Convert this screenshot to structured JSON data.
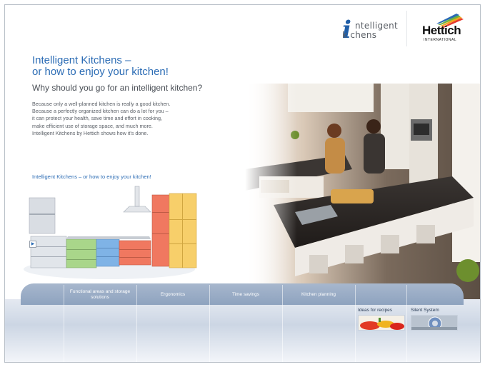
{
  "header": {
    "brand_logo": {
      "line1": "ntelligent",
      "line2": "k  chens",
      "letter": "i"
    },
    "partner_logo": {
      "name": "Hettich",
      "sub": "INTERNATIONAL"
    }
  },
  "intro": {
    "title_line1": "Intelligent Kitchens –",
    "title_line2": "or how to enjoy your kitchen!",
    "subtitle": "Why should you go for an intelligent kitchen?",
    "body_lines": [
      "Because only a well-planned kitchen is really a good kitchen.",
      "Because a perfectly organized kitchen can do a lot for you –",
      "it can protect your health, save time and effort in cooking,",
      "make efficient use of storage space, and much more.",
      "Intelligent Kitchens by Hettich shows how it's done."
    ],
    "video_link": "Intelligent Kitchens – or how to enjoy your kitchen!",
    "play_icon": "play-icon"
  },
  "nav": {
    "items": [
      "Functional areas and storage solutions",
      "Ergonomics",
      "Time savings",
      "Kitchen planning"
    ],
    "promos": [
      {
        "label": "Ideas for recipes",
        "icon": "peppers-image"
      },
      {
        "label": "Silent System",
        "icon": "drawer-damper-image"
      }
    ]
  },
  "colors": {
    "accent": "#2d6db5",
    "nav_bar": "#9aabc4",
    "cabinet_green": "#a9d68a",
    "cabinet_blue": "#7fb3e6",
    "cabinet_red": "#f07860",
    "cabinet_yellow": "#f7cf6a"
  }
}
